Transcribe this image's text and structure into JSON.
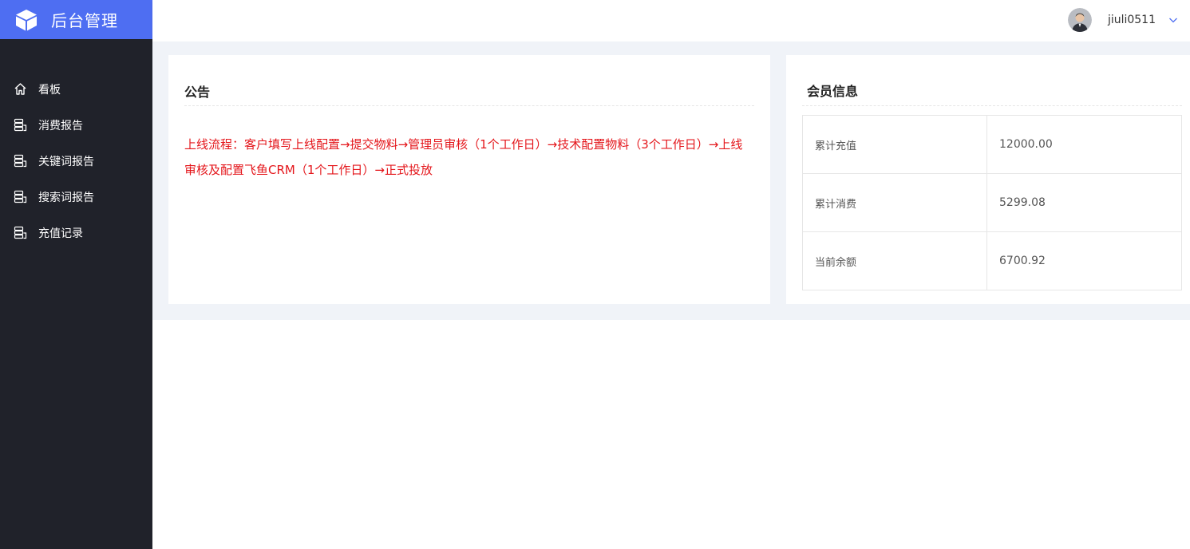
{
  "app": {
    "title": "后台管理",
    "icon": "cube-icon",
    "brand_color": "#4e6ef2",
    "sidebar_color": "#20222a"
  },
  "sidebar": {
    "items": [
      {
        "label": "看板",
        "icon": "home-icon"
      },
      {
        "label": "消费报告",
        "icon": "database-icon"
      },
      {
        "label": "关键词报告",
        "icon": "database-icon"
      },
      {
        "label": "搜索词报告",
        "icon": "database-icon"
      },
      {
        "label": "充值记录",
        "icon": "database-icon"
      }
    ]
  },
  "header": {
    "username": "jiuli0511",
    "avatar_icon": "avatar",
    "menu_icon": "chevron-down-icon"
  },
  "notice": {
    "title": "公告",
    "text": "上线流程：客户填写上线配置→提交物料→管理员审核（1个工作日）→技术配置物料（3个工作日）→上线审核及配置飞鱼CRM（1个工作日）→正式投放",
    "text_color": "#e4161b"
  },
  "member": {
    "title": "会员信息",
    "rows": [
      {
        "label": "累计充值",
        "value": "12000.00"
      },
      {
        "label": "累计消费",
        "value": "5299.08"
      },
      {
        "label": "当前余额",
        "value": "6700.92"
      }
    ]
  }
}
